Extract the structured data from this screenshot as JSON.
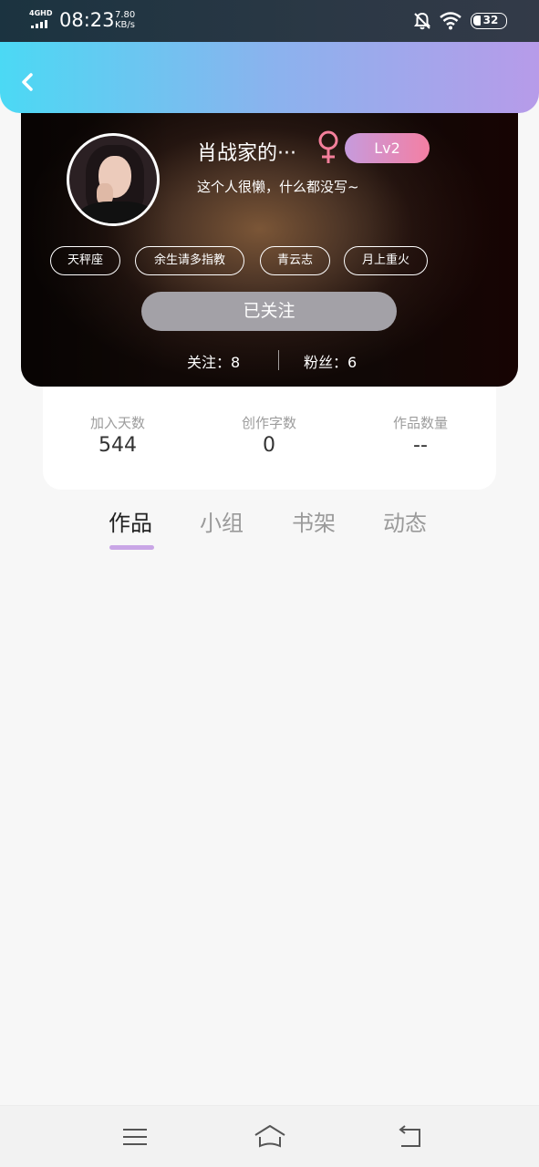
{
  "status_bar": {
    "network": "4GHD",
    "time": "08:23",
    "speed_value": "7.80",
    "speed_unit": "KB/s",
    "battery": "32",
    "icons": [
      "bell-muted-icon",
      "wifi-icon",
      "battery-icon"
    ]
  },
  "header": {
    "back_icon": "chevron-left-icon",
    "gradient": [
      "#4bd9f4",
      "#b79be9"
    ]
  },
  "profile": {
    "nickname": "肖战家的···",
    "gender_icon": "female-icon",
    "gender_color": "#f47f9b",
    "level": "Lv2",
    "bio": "这个人很懒，什么都没写~",
    "tags": [
      "天秤座",
      "余生请多指教",
      "青云志",
      "月上重火"
    ],
    "follow_button": "已关注",
    "following_label": "关注：",
    "following_count": "8",
    "fans_label": "粉丝：",
    "fans_count": "6"
  },
  "stats": [
    {
      "label": "加入天数",
      "value": "544"
    },
    {
      "label": "创作字数",
      "value": "0"
    },
    {
      "label": "作品数量",
      "value": "--"
    }
  ],
  "tabs": [
    {
      "label": "作品",
      "active": true
    },
    {
      "label": "小组",
      "active": false
    },
    {
      "label": "书架",
      "active": false
    },
    {
      "label": "动态",
      "active": false
    }
  ],
  "nav_bar": {
    "icons": [
      "menu-icon",
      "home-icon",
      "back-icon"
    ]
  },
  "colors": {
    "accent": "#c9a6e6",
    "follow_button_bg": "#a3a1a7",
    "level_badge": [
      "#c69bdd",
      "#f47fa3"
    ]
  }
}
